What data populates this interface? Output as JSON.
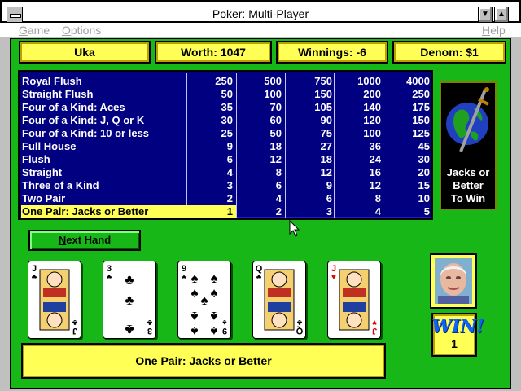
{
  "window": {
    "title": "Poker: Multi-Player",
    "minimize_glyph": "▼",
    "maximize_glyph": "▲"
  },
  "menu": {
    "game_first": "G",
    "game_rest": "ame",
    "options_first": "O",
    "options_rest": "ptions",
    "help_first": "H",
    "help_rest": "elp"
  },
  "info": {
    "player": "Uka",
    "worth": "Worth: 1047",
    "winnings": "Winnings: -6",
    "denom": "Denom: $1"
  },
  "paytable": {
    "selected_row": 10,
    "rows": [
      {
        "hand": "Royal Flush",
        "payouts": [
          "250",
          "500",
          "750",
          "1000",
          "4000"
        ]
      },
      {
        "hand": "Straight Flush",
        "payouts": [
          "50",
          "100",
          "150",
          "200",
          "250"
        ]
      },
      {
        "hand": "Four of a Kind: Aces",
        "payouts": [
          "35",
          "70",
          "105",
          "140",
          "175"
        ]
      },
      {
        "hand": "Four of a Kind: J, Q or K",
        "payouts": [
          "30",
          "60",
          "90",
          "120",
          "150"
        ]
      },
      {
        "hand": "Four of a Kind: 10 or less",
        "payouts": [
          "25",
          "50",
          "75",
          "100",
          "125"
        ]
      },
      {
        "hand": "Full House",
        "payouts": [
          "9",
          "18",
          "27",
          "36",
          "45"
        ]
      },
      {
        "hand": "Flush",
        "payouts": [
          "6",
          "12",
          "18",
          "24",
          "30"
        ]
      },
      {
        "hand": "Straight",
        "payouts": [
          "4",
          "8",
          "12",
          "16",
          "20"
        ]
      },
      {
        "hand": "Three of a Kind",
        "payouts": [
          "3",
          "6",
          "9",
          "12",
          "15"
        ]
      },
      {
        "hand": "Two Pair",
        "payouts": [
          "2",
          "4",
          "6",
          "8",
          "10"
        ]
      },
      {
        "hand": "One Pair: Jacks or Better",
        "payouts": [
          "1",
          "2",
          "3",
          "4",
          "5"
        ]
      }
    ]
  },
  "game_panel": {
    "line1": "Jacks or",
    "line2": "Better",
    "line3": "To Win",
    "icon": "globe-with-sword-icon"
  },
  "buttons": {
    "next_hand_first": "N",
    "next_hand_rest": "ext Hand"
  },
  "cards": [
    {
      "rank": "J",
      "suit": "♣",
      "color": "#000000"
    },
    {
      "rank": "3",
      "suit": "♣",
      "color": "#000000"
    },
    {
      "rank": "9",
      "suit": "♠",
      "color": "#000000"
    },
    {
      "rank": "Q",
      "suit": "♣",
      "color": "#000000"
    },
    {
      "rank": "J",
      "suit": "♥",
      "color": "#e00000"
    }
  ],
  "win": {
    "label": "WIN!",
    "count": "1"
  },
  "result": "One Pair: Jacks or Better",
  "colors": {
    "felt": "#17b717",
    "paytable": "#000080",
    "panel_yellow": "#ffff55"
  }
}
